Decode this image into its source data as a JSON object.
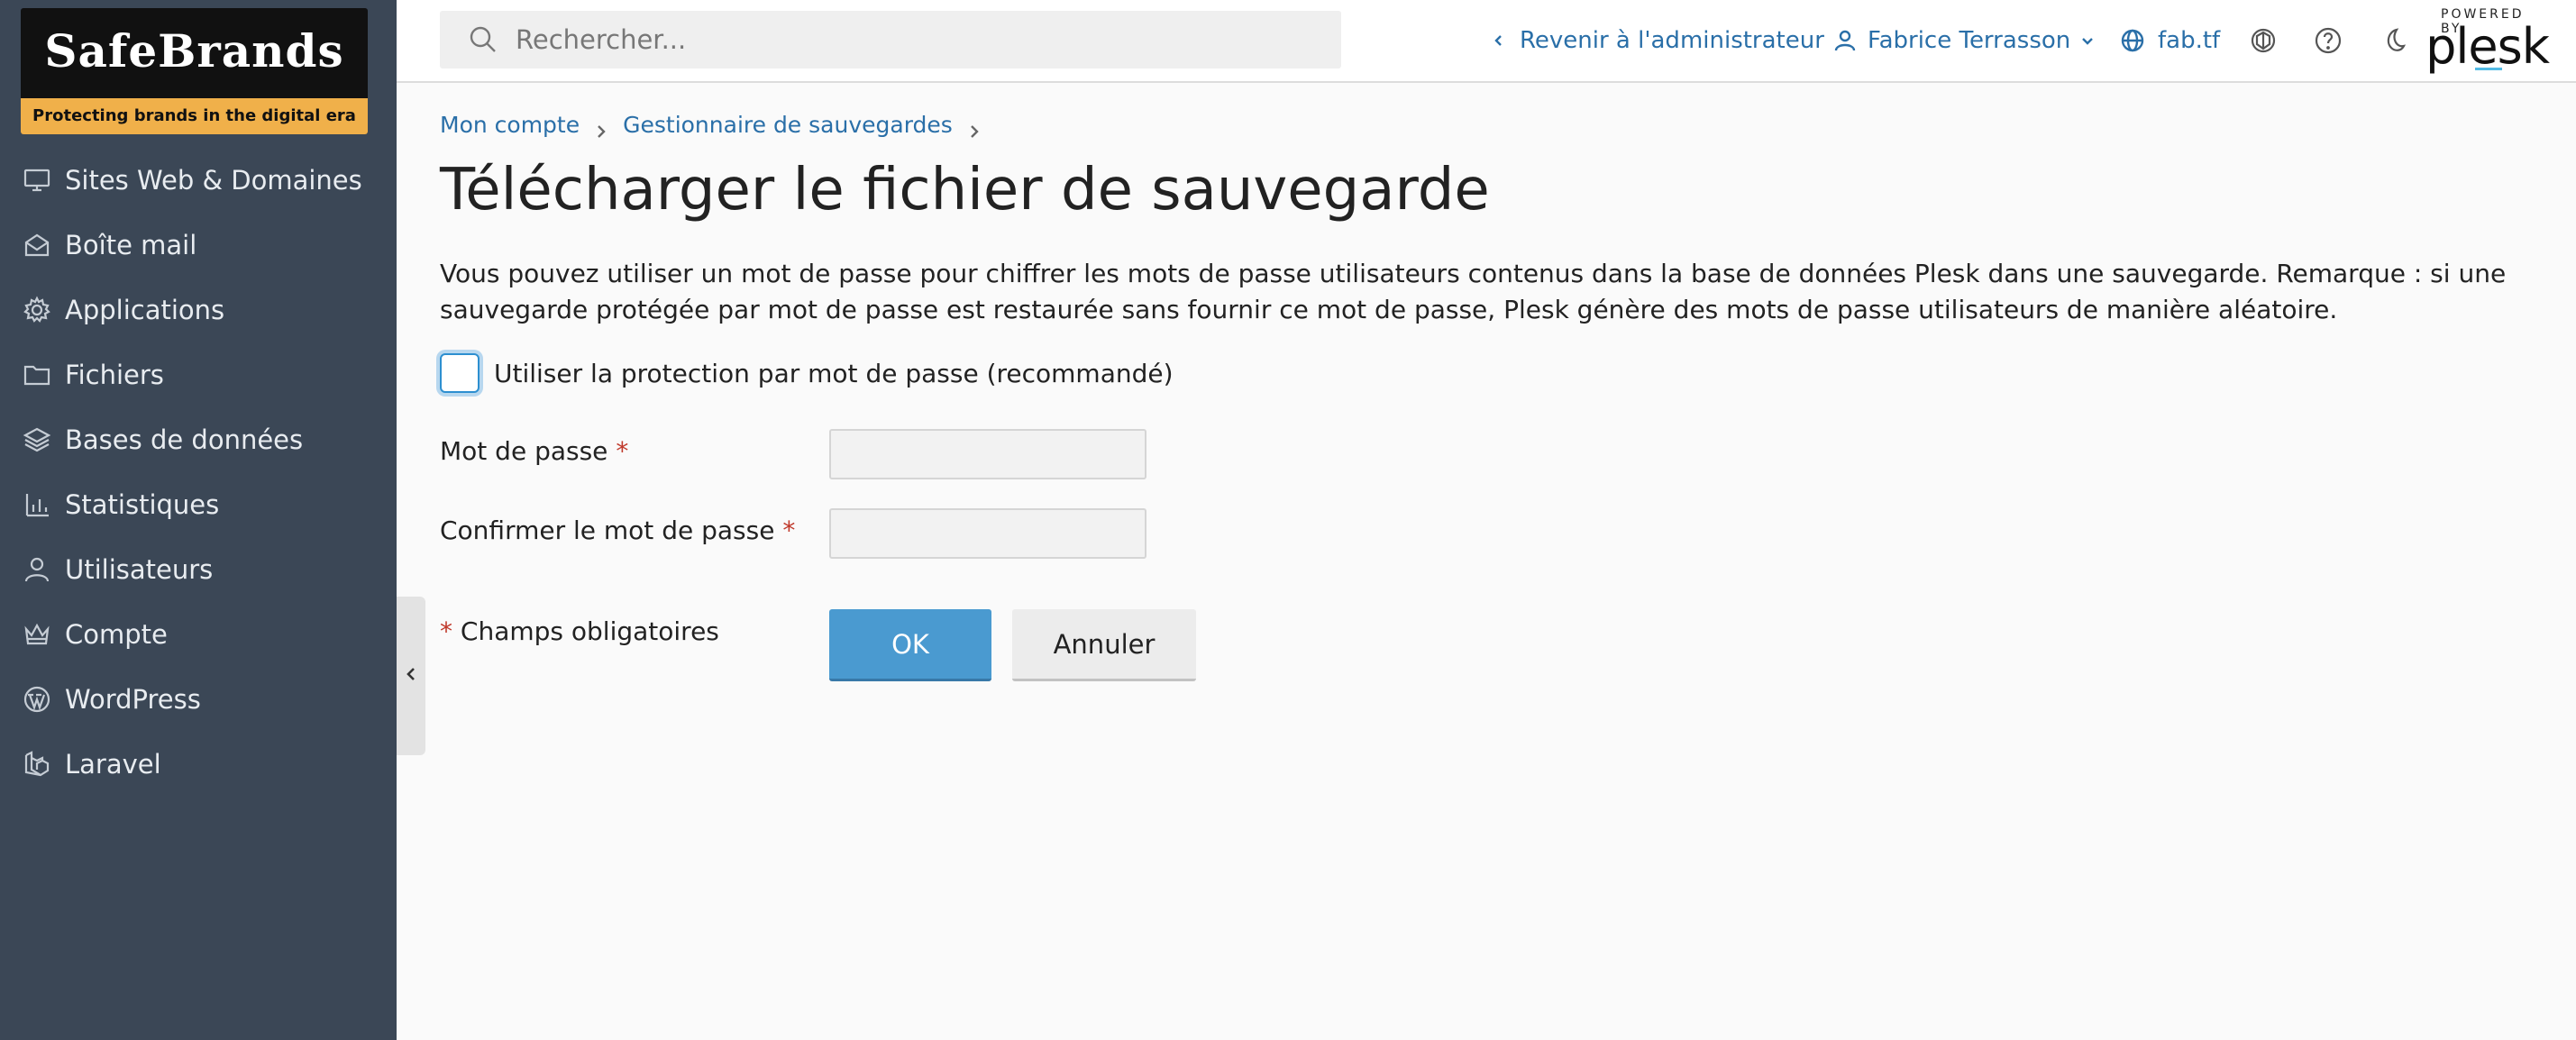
{
  "brand": {
    "logo_text": "SafeBrands",
    "logo_tagline": "Protecting brands in the digital era",
    "accent_color": "#f0b04a"
  },
  "sidebar": {
    "items": [
      {
        "label": "Sites Web & Domaines",
        "icon": "monitor-icon"
      },
      {
        "label": "Boîte mail",
        "icon": "mail-icon"
      },
      {
        "label": "Applications",
        "icon": "gear-icon"
      },
      {
        "label": "Fichiers",
        "icon": "folder-icon"
      },
      {
        "label": "Bases de données",
        "icon": "layers-icon"
      },
      {
        "label": "Statistiques",
        "icon": "bar-chart-icon"
      },
      {
        "label": "Utilisateurs",
        "icon": "user-icon"
      },
      {
        "label": "Compte",
        "icon": "crown-icon"
      },
      {
        "label": "WordPress",
        "icon": "wordpress-icon"
      },
      {
        "label": "Laravel",
        "icon": "laravel-icon"
      }
    ]
  },
  "topbar": {
    "search_placeholder": "Rechercher...",
    "back_to_admin": "Revenir à l'administrateur",
    "user_name": "Fabrice Terrasson",
    "domain": "fab.tf",
    "powered_by": "POWERED BY",
    "plesk": "plesk"
  },
  "breadcrumb": {
    "items": [
      "Mon compte",
      "Gestionnaire de sauvegardes"
    ]
  },
  "page": {
    "title": "Télécharger le fichier de sauvegarde",
    "description": "Vous pouvez utiliser un mot de passe pour chiffrer les mots de passe utilisateurs contenus dans la base de données Plesk dans une sauvegarde. Remarque : si une sauvegarde protégée par mot de passe est restaurée sans fournir ce mot de passe, Plesk génère des mots de passe utilisateurs de manière aléatoire.",
    "checkbox_label": "Utiliser la protection par mot de passe (recommandé)",
    "checkbox_checked": false
  },
  "form": {
    "password_label": "Mot de passe",
    "confirm_label": "Confirmer le mot de passe",
    "required_marker": "*",
    "required_note": "Champs obligatoires",
    "password_value": "",
    "confirm_value": ""
  },
  "buttons": {
    "ok": "OK",
    "cancel": "Annuler"
  },
  "colors": {
    "sidebar_bg": "#3b4756",
    "link": "#2a6fa8",
    "primary_button": "#4a9ad0",
    "required": "#c0392b"
  }
}
